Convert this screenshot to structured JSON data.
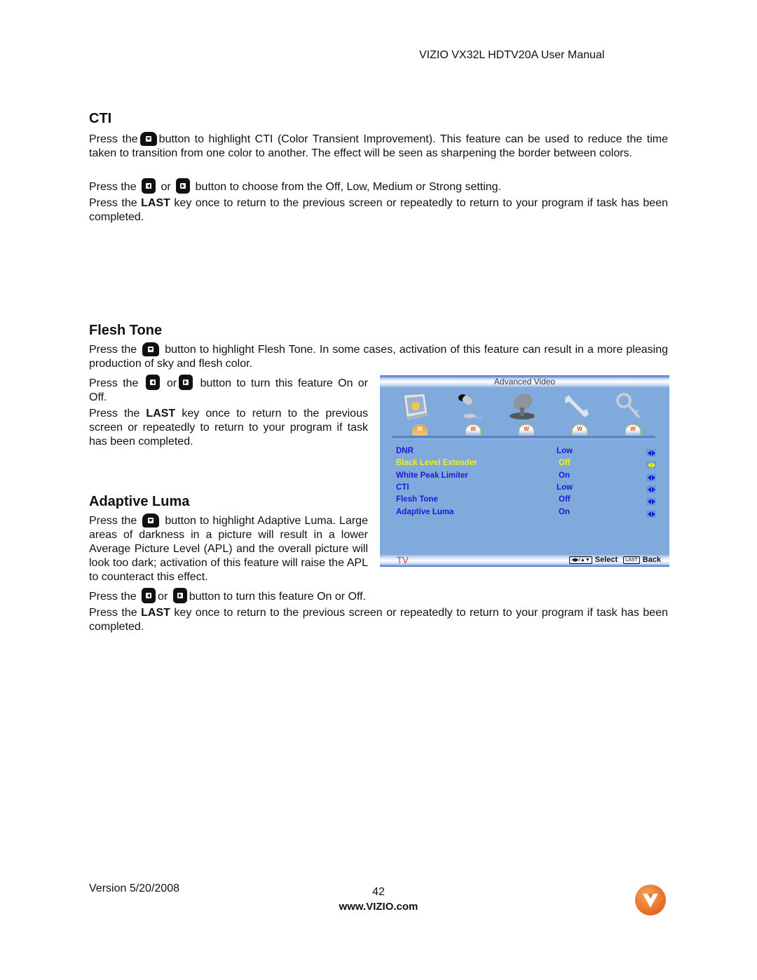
{
  "header": {
    "title": "VIZIO VX32L HDTV20A User Manual"
  },
  "sections": {
    "cti": {
      "heading": "CTI",
      "p1_a": "Press the",
      "p1_b": "button to highlight CTI (Color Transient Improvement).  This feature can be used to reduce the time taken to transition from one color to another.  The effect will be seen as sharpening the border between colors.",
      "p2_a": "Press the",
      "p2_or": "or",
      "p2_b": "button to choose from the Off, Low, Medium or Strong setting.",
      "p3_a": "Press the",
      "p3_key": "LAST",
      "p3_b": "key once to return to the previous screen or repeatedly to return to your program if task has been completed."
    },
    "flesh_tone": {
      "heading": "Flesh Tone",
      "p1_a": "Press the",
      "p1_b": "button to highlight Flesh Tone.  In some cases, activation of this feature can result in a more pleasing production of sky and flesh color.",
      "p2_a": "Press the",
      "p2_or": "or",
      "p2_b": "button to turn this feature On or Off.",
      "p3_a": "Press the",
      "p3_key": "LAST",
      "p3_b": "key once to return to the previous screen or repeatedly to return to your program if task has been completed."
    },
    "adaptive_luma": {
      "heading": "Adaptive Luma",
      "p1_a": "Press the",
      "p1_b": "button to highlight Adaptive Luma. Large areas of darkness in a picture will result in a lower Average Picture Level (APL) and the overall picture will look too dark; activation of this feature will raise the APL to counteract this effect.",
      "p2_a": "Press the",
      "p2_or": "or",
      "p2_b": "button to turn this feature On or Off.",
      "p3_a": "Press the",
      "p3_key": "LAST",
      "p3_b": "key once to return to the previous screen or repeatedly to return to your program if task has been completed."
    }
  },
  "osd": {
    "title": "Advanced Video",
    "icons": [
      "picture-icon",
      "microphone-icon",
      "satellite-dish-icon",
      "wrench-icon",
      "key-icon"
    ],
    "rows": [
      {
        "label": "DNR",
        "value": "Low",
        "highlighted": false
      },
      {
        "label": "Black Level Extender",
        "value": "Off",
        "highlighted": true
      },
      {
        "label": "White Peak Limiter",
        "value": "On",
        "highlighted": false
      },
      {
        "label": "CTI",
        "value": "Low",
        "highlighted": false
      },
      {
        "label": "Flesh Tone",
        "value": "Off",
        "highlighted": false
      },
      {
        "label": "Adaptive Luma",
        "value": "On",
        "highlighted": false
      }
    ],
    "source": "TV",
    "help_select_key": "◀▶/▲▼",
    "help_select": "Select",
    "help_back_key": "LAST",
    "help_back": "Back",
    "colors": {
      "normal": "#1a1ad6",
      "highlight": "#f2f20a",
      "background": "#80a9dc",
      "source": "#ee2b2b"
    }
  },
  "footer": {
    "version": "Version 5/20/2008",
    "page": "42",
    "url": "www.VIZIO.com",
    "logo_letter": "V"
  }
}
